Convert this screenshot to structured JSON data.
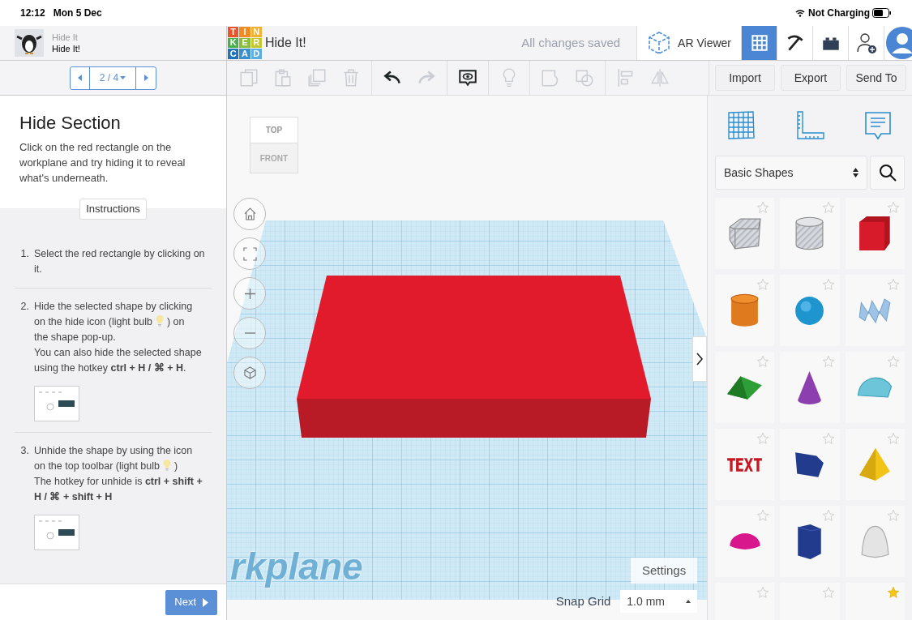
{
  "status_bar": {
    "time": "12:12",
    "date": "Mon 5 Dec",
    "battery_text": "Not Charging"
  },
  "lesson_header": {
    "course": "Hide It",
    "title": "Hide It!"
  },
  "pager": {
    "label": "2 / 4"
  },
  "app_header": {
    "logo_letters": [
      "T",
      "I",
      "N",
      "K",
      "E",
      "R",
      "C",
      "A",
      "D"
    ],
    "title": "Hide It!",
    "save_status": "All changes saved",
    "ar_viewer": "AR Viewer",
    "view_buttons": [
      {
        "kind": "grid",
        "selected": true
      },
      {
        "kind": "pickaxe",
        "selected": false
      },
      {
        "kind": "brick",
        "selected": false
      }
    ]
  },
  "toolbar": {
    "tools": [
      {
        "kind": "copy",
        "disabled": true
      },
      {
        "kind": "paste",
        "disabled": true
      },
      {
        "kind": "duplicate",
        "disabled": true
      },
      {
        "kind": "delete",
        "disabled": true
      },
      {
        "kind": "undo",
        "disabled": false
      },
      {
        "kind": "redo",
        "disabled": true
      },
      {
        "kind": "notes",
        "disabled": false
      },
      {
        "kind": "bulb",
        "disabled": true
      },
      {
        "kind": "group",
        "disabled": true
      },
      {
        "kind": "ungroup",
        "disabled": true
      },
      {
        "kind": "align",
        "disabled": true
      },
      {
        "kind": "mirror",
        "disabled": true
      }
    ],
    "buttons": [
      "Import",
      "Export",
      "Send To"
    ]
  },
  "lesson": {
    "heading": "Hide Section",
    "intro": "Click on the red rectangle on the workplane and try hiding it to reveal what's underneath.",
    "instructions_label": "Instructions",
    "steps": [
      {
        "number": "1.",
        "parts": [
          {
            "kind": "text",
            "text": "Select the red rectangle by clicking on it."
          }
        ],
        "thumbnail": false
      },
      {
        "number": "2.",
        "parts": [
          {
            "kind": "text",
            "text": "Hide the selected shape by clicking"
          },
          {
            "kind": "line",
            "items": [
              {
                "kind": "text",
                "text": "on the hide icon (light bulb"
              },
              {
                "kind": "bulb"
              },
              {
                "kind": "text",
                "text": ") on"
              }
            ]
          },
          {
            "kind": "text",
            "text": "the shape pop-up."
          },
          {
            "kind": "text",
            "text": "You can also hide the selected shape using the hotkey **ctrl + H / ⌘ + H**."
          }
        ],
        "thumbnail": true
      },
      {
        "number": "3.",
        "parts": [
          {
            "kind": "text",
            "text": "Unhide the shape by using the icon"
          },
          {
            "kind": "line",
            "items": [
              {
                "kind": "text",
                "text": "on the top toolbar (light bulb"
              },
              {
                "kind": "bulb"
              },
              {
                "kind": "text",
                "text": ")"
              }
            ]
          },
          {
            "kind": "text",
            "text": "The hotkey for unhide is **ctrl + shift + H / ⌘ + shift + H**"
          }
        ],
        "thumbnail": true
      }
    ],
    "next_button": "Next"
  },
  "canvas": {
    "view_cube": {
      "top": "TOP",
      "front": "FRONT"
    },
    "nav_buttons": [
      {
        "kind": "home"
      },
      {
        "kind": "fit"
      },
      {
        "kind": "zoom-in"
      },
      {
        "kind": "zoom-out"
      },
      {
        "kind": "perspective"
      }
    ],
    "workplane_label": "rkplane",
    "settings_button": "Settings",
    "snap_grid_label": "Snap Grid",
    "snap_grid_value": "1.0 mm"
  },
  "shape_panel": {
    "tabs": [
      {
        "kind": "grid"
      },
      {
        "kind": "ruler"
      },
      {
        "kind": "notes"
      }
    ],
    "category": "Basic Shapes",
    "shapes": [
      {
        "kind": "box-hole",
        "favorite": false
      },
      {
        "kind": "cylinder-hole",
        "favorite": false
      },
      {
        "kind": "box",
        "favorite": false
      },
      {
        "kind": "cylinder",
        "favorite": false
      },
      {
        "kind": "sphere",
        "favorite": false
      },
      {
        "kind": "scribble",
        "favorite": false
      },
      {
        "kind": "roof",
        "favorite": false
      },
      {
        "kind": "cone",
        "favorite": false
      },
      {
        "kind": "round-roof",
        "favorite": false
      },
      {
        "kind": "text",
        "favorite": false
      },
      {
        "kind": "polygon",
        "favorite": false
      },
      {
        "kind": "pyramid",
        "favorite": false
      },
      {
        "kind": "half-sphere",
        "favorite": false
      },
      {
        "kind": "hexagon",
        "favorite": false
      },
      {
        "kind": "paraboloid",
        "favorite": false
      },
      {
        "kind": "partial",
        "favorite": false
      },
      {
        "kind": "partial",
        "favorite": false
      },
      {
        "kind": "partial",
        "favorite": true
      }
    ]
  }
}
